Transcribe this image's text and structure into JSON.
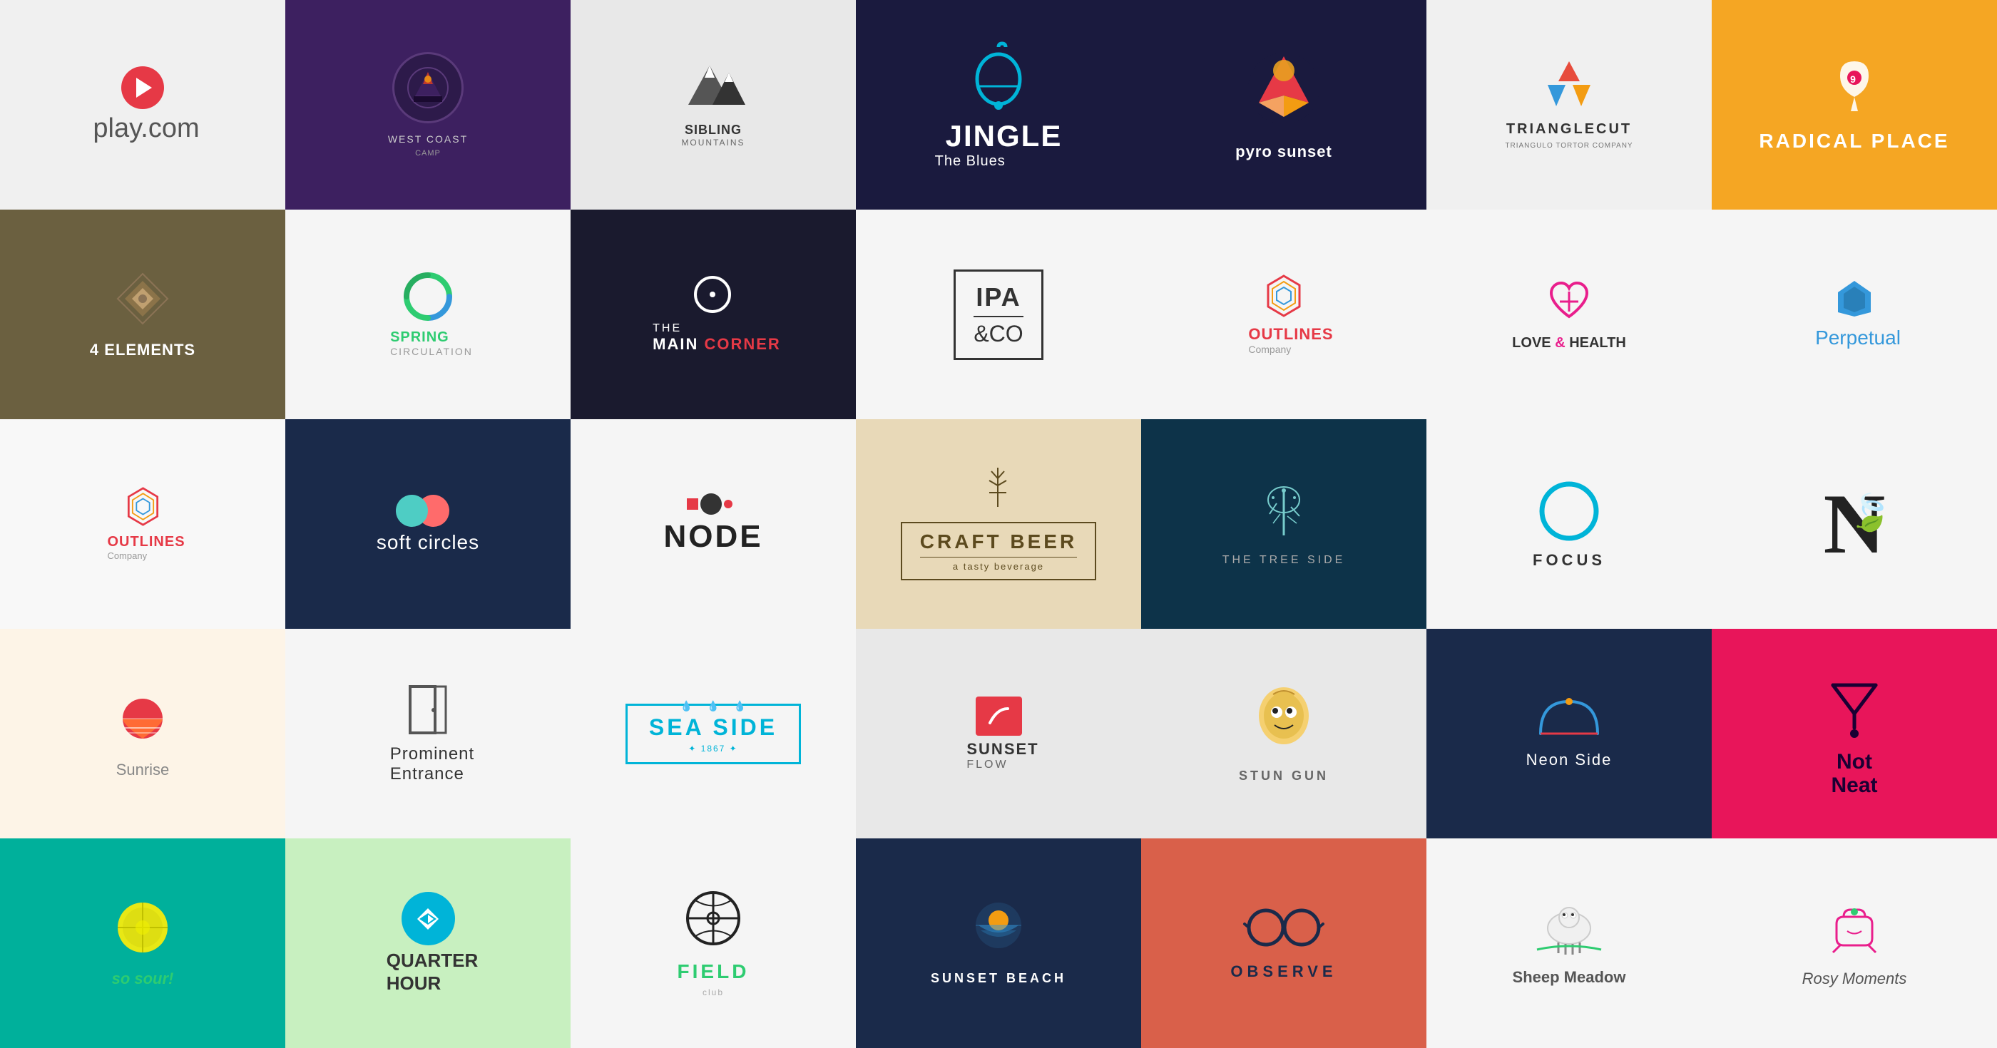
{
  "logos": [
    {
      "id": "play",
      "name": "play.com",
      "bg": "#f0f0f0"
    },
    {
      "id": "westcoast",
      "name": "WEST COAST CAMP",
      "bg": "#3d2060"
    },
    {
      "id": "sibling",
      "name": "SIBLING MOUNTAINS",
      "bg": "#e8e8e8"
    },
    {
      "id": "jingle",
      "name": "JINGLE The Blues",
      "bg": "#1a1a3e"
    },
    {
      "id": "pyro",
      "name": "pyro sunset",
      "bg": "#1a1a3e"
    },
    {
      "id": "trianglecut",
      "name": "TRIANGLECUT",
      "sub": "TRIANGULO TORTOR COMPANY",
      "bg": "#f0f0f0"
    },
    {
      "id": "radicalplace",
      "name": "RADICAL PLACE",
      "bg": "#f5a623"
    },
    {
      "id": "4elements",
      "name": "4 ELEMENTS",
      "bg": "#6b6040"
    },
    {
      "id": "springcirc",
      "name": "SPRING CIRCULATION",
      "bg": "#f5f5f5"
    },
    {
      "id": "maincorner",
      "name": "THE MAIN CORNER",
      "bg": "#1a1a2e"
    },
    {
      "id": "ipa",
      "name": "IPA &CO",
      "bg": "#f5f5f5"
    },
    {
      "id": "outlines2",
      "name": "OUTLINES Company",
      "bg": "#f5f5f5"
    },
    {
      "id": "lovehealth",
      "name": "LOVE & HEALTH",
      "bg": "#f5f5f5"
    },
    {
      "id": "perpetual",
      "name": "Perpetual",
      "bg": "#f5f5f5"
    },
    {
      "id": "outlines3",
      "name": "OUTLINES Company",
      "bg": "#f8f8f8"
    },
    {
      "id": "softcircles",
      "name": "soft circles",
      "bg": "#1a2a4a"
    },
    {
      "id": "node",
      "name": "NODE",
      "bg": "#f5f5f5"
    },
    {
      "id": "craftbeer",
      "name": "CRAFT BEER",
      "sub": "a tasty beverage",
      "bg": "#e8d9b8"
    },
    {
      "id": "treeside",
      "name": "THE TREE SIDE",
      "bg": "#0d3349"
    },
    {
      "id": "focus",
      "name": "FOCUS",
      "bg": "#f5f5f5"
    },
    {
      "id": "nleaf",
      "name": "N",
      "bg": "#f5f5f5"
    },
    {
      "id": "sunrise",
      "name": "Sunrise",
      "bg": "#fdf4e7"
    },
    {
      "id": "prominent",
      "name": "Prominent Entrance",
      "bg": "#f5f5f5"
    },
    {
      "id": "seaside",
      "name": "SEA SIDE",
      "year": "1867",
      "bg": "#f5f5f5"
    },
    {
      "id": "sunsetflow",
      "name": "SUNSET FLOW",
      "bg": "#e8e8e8"
    },
    {
      "id": "stungun",
      "name": "STUN GUN",
      "bg": "#e8e8e8"
    },
    {
      "id": "neonside",
      "name": "Neon Side",
      "bg": "#1a2a4a"
    },
    {
      "id": "notneat",
      "name": "Not Neat",
      "bg": "#e8155a"
    },
    {
      "id": "sosour",
      "name": "so sour!",
      "bg": "#00b09b"
    },
    {
      "id": "quarterhour",
      "name": "QUARTER HOUR",
      "bg": "#c8f0c0"
    },
    {
      "id": "field",
      "name": "FIELD",
      "bg": "#f5f5f5"
    },
    {
      "id": "sunsetbeach",
      "name": "SUNSET BEACH",
      "bg": "#1a2a4a"
    },
    {
      "id": "observe",
      "name": "OBSERVE",
      "bg": "#d9604a"
    },
    {
      "id": "sheepmead",
      "name": "Sheep Meadow",
      "bg": "#f5f5f5"
    },
    {
      "id": "rosymom",
      "name": "Rosy Moments",
      "bg": "#f5f5f5"
    }
  ]
}
